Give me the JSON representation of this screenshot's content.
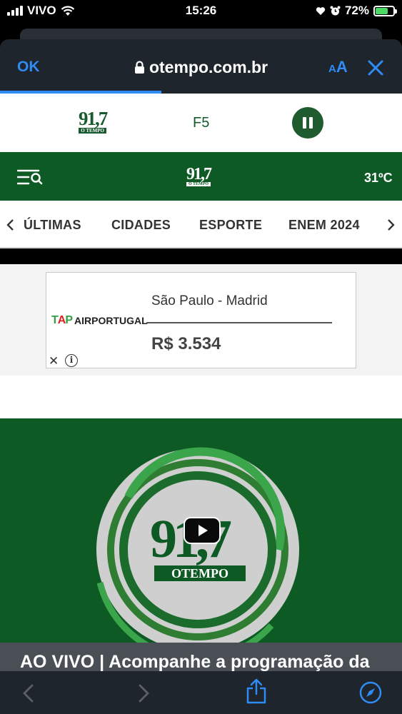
{
  "status_bar": {
    "carrier": "VIVO",
    "time": "15:26",
    "battery": "72%"
  },
  "browser": {
    "ok_label": "OK",
    "url": "otempo.com.br",
    "aa_small": "A",
    "aa_big": "A"
  },
  "player": {
    "logo_num": "91,7",
    "logo_sub": "O TEMPO",
    "station": "F5"
  },
  "header": {
    "logo_num": "91,7",
    "logo_sub": "O TEMPO",
    "temperature": "31ºC"
  },
  "nav": {
    "items": [
      "ÚLTIMAS",
      "CIDADES",
      "ESPORTE",
      "ENEM 2024"
    ]
  },
  "ad": {
    "brand": "AIRPORTUGAL",
    "brand_logo": "TAP",
    "route": "São Paulo - Madrid",
    "price": "R$ 3.534",
    "close": "✕",
    "info": "i"
  },
  "video": {
    "logo_num": "91,7",
    "logo_sub": "OTEMPO"
  },
  "headline": "AO VIVO | Acompanhe a programação da",
  "colors": {
    "brand_green": "#0e5a25",
    "accent_blue": "#2f8cf5",
    "toolbar": "#1f252c"
  }
}
